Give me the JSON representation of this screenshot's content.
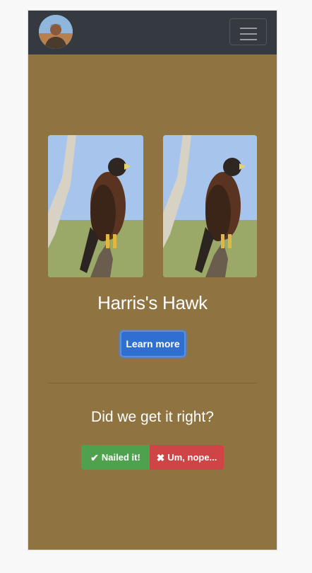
{
  "navbar": {
    "avatar_icon": "user-avatar-icon",
    "menu_icon": "hamburger-menu-icon"
  },
  "result": {
    "bird_name": "Harris's Hawk",
    "learn_more_label": "Learn more"
  },
  "feedback": {
    "question": "Did we get it right?",
    "yes_label": "Nailed it!",
    "yes_icon": "✔",
    "no_label": "Um, nope...",
    "no_icon": "✖"
  },
  "colors": {
    "background": "#8f7441",
    "navbar": "#343a40",
    "primary": "#2f6fd0",
    "success": "#4ea24e",
    "danger": "#cf4545"
  }
}
